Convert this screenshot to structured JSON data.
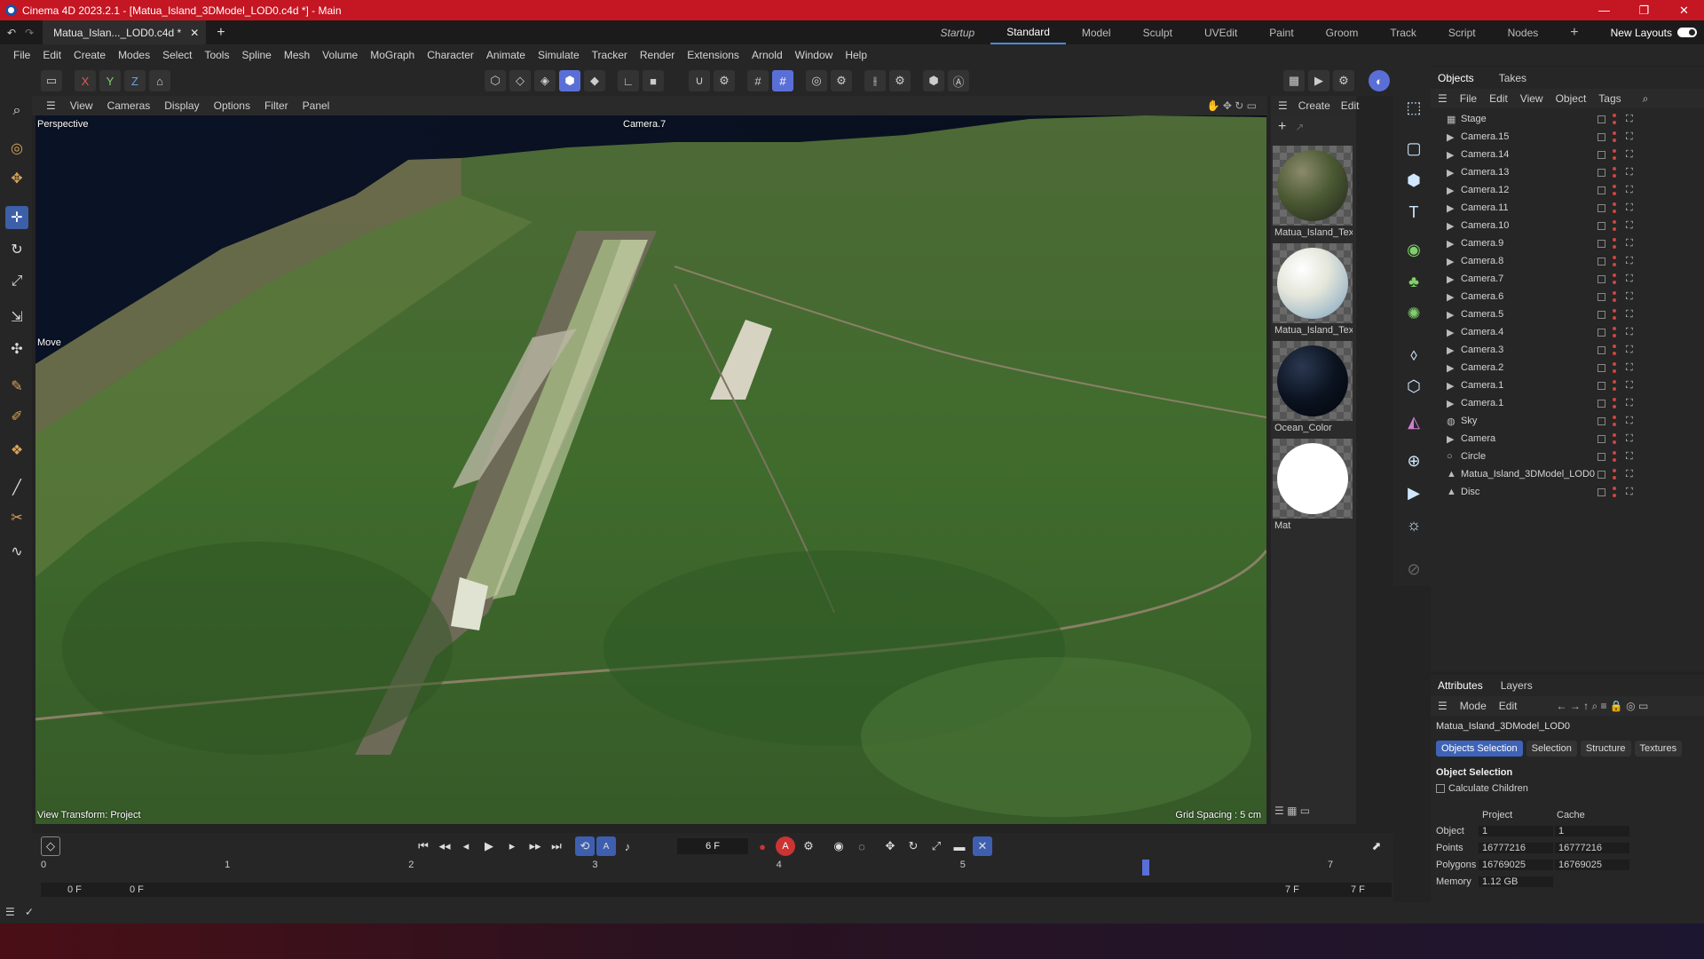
{
  "window": {
    "title": "Cinema 4D 2023.2.1 - [Matua_Island_3DModel_LOD0.c4d *] - Main"
  },
  "tabs": {
    "doc": "Matua_Islan..._LOD0.c4d *",
    "layouts": [
      "Startup",
      "Standard",
      "Model",
      "Sculpt",
      "UVEdit",
      "Paint",
      "Groom",
      "Track",
      "Script",
      "Nodes"
    ],
    "new_layouts": "New Layouts"
  },
  "menu": [
    "File",
    "Edit",
    "Create",
    "Modes",
    "Select",
    "Tools",
    "Spline",
    "Mesh",
    "Volume",
    "MoGraph",
    "Character",
    "Animate",
    "Simulate",
    "Tracker",
    "Render",
    "Extensions",
    "Arnold",
    "Window",
    "Help"
  ],
  "toolbar": {
    "axes": [
      "X",
      "Y",
      "Z"
    ]
  },
  "viewport": {
    "menu": [
      "View",
      "Cameras",
      "Display",
      "Options",
      "Filter",
      "Panel"
    ],
    "label": "Perspective",
    "camera": "Camera.7",
    "tool": "Move",
    "transform": "View Transform: Project",
    "grid": "Grid Spacing : 5 cm"
  },
  "materials": {
    "menu": [
      "Create",
      "Edit"
    ],
    "items": [
      {
        "label": "Matua_Island_Text",
        "color": "#4c5a34"
      },
      {
        "label": "Matua_Island_Text",
        "color": "#e4e6da"
      },
      {
        "label": "Ocean_Color",
        "color": "#0b1320"
      },
      {
        "label": "Mat",
        "color": "#ffffff"
      }
    ]
  },
  "objects": {
    "tabs": [
      "Objects",
      "Takes"
    ],
    "menu": [
      "File",
      "Edit",
      "View",
      "Object",
      "Tags"
    ],
    "rows": [
      {
        "name": "Stage",
        "icon": "stage-icon"
      },
      {
        "name": "Camera.15",
        "icon": "camera-icon"
      },
      {
        "name": "Camera.14",
        "icon": "camera-icon"
      },
      {
        "name": "Camera.13",
        "icon": "camera-icon"
      },
      {
        "name": "Camera.12",
        "icon": "camera-icon"
      },
      {
        "name": "Camera.11",
        "icon": "camera-icon"
      },
      {
        "name": "Camera.10",
        "icon": "camera-icon"
      },
      {
        "name": "Camera.9",
        "icon": "camera-icon"
      },
      {
        "name": "Camera.8",
        "icon": "camera-icon"
      },
      {
        "name": "Camera.7",
        "icon": "camera-icon"
      },
      {
        "name": "Camera.6",
        "icon": "camera-icon"
      },
      {
        "name": "Camera.5",
        "icon": "camera-icon"
      },
      {
        "name": "Camera.4",
        "icon": "camera-icon"
      },
      {
        "name": "Camera.3",
        "icon": "camera-icon"
      },
      {
        "name": "Camera.2",
        "icon": "camera-icon"
      },
      {
        "name": "Camera.1",
        "icon": "camera-icon"
      },
      {
        "name": "Camera.1",
        "icon": "camera-icon"
      },
      {
        "name": "Sky",
        "icon": "sky-icon"
      },
      {
        "name": "Camera",
        "icon": "camera-icon"
      },
      {
        "name": "Circle",
        "icon": "circle-icon"
      },
      {
        "name": "Matua_Island_3DModel_LOD0",
        "icon": "polygon-object-icon"
      },
      {
        "name": "Disc",
        "icon": "polygon-object-icon"
      }
    ]
  },
  "attributes": {
    "tabs": [
      "Attributes",
      "Layers"
    ],
    "menu": [
      "Mode",
      "Edit"
    ],
    "object_name": "Matua_Island_3DModel_LOD0",
    "subtabs": [
      "Objects Selection",
      "Selection",
      "Structure",
      "Textures"
    ],
    "section": "Object Selection",
    "checkbox": "Calculate Children",
    "columns": [
      "Project",
      "Cache"
    ],
    "rows": [
      {
        "label": "Object",
        "project": "1",
        "cache": "1"
      },
      {
        "label": "Points",
        "project": "16777216",
        "cache": "16777216"
      },
      {
        "label": "Polygons",
        "project": "16769025",
        "cache": "16769025"
      },
      {
        "label": "Memory",
        "project": "1.12 GB",
        "cache": ""
      }
    ]
  },
  "timeline": {
    "frame": "6 F",
    "ticks": [
      "0",
      "1",
      "2",
      "3",
      "4",
      "5",
      "6",
      "7"
    ],
    "current": 6,
    "max": 7,
    "start": "0 F",
    "start2": "0 F",
    "end": "7 F",
    "end2": "7 F"
  }
}
